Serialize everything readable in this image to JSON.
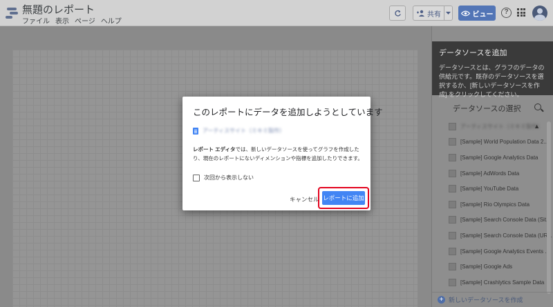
{
  "app": {
    "title": "無題のレポート",
    "menu": [
      "ファイル",
      "表示",
      "ページ",
      "ヘルプ"
    ]
  },
  "toolbar": {
    "share_label": "共有",
    "view_label": "ビュー"
  },
  "panel": {
    "heading": "データソースを追加",
    "description": "データソースとは、グラフのデータの供給元です。既存のデータソースを選択するか、[新しいデータソースを作成] をクリックしてください。",
    "subheading": "データソースの選択",
    "items": [
      "アーティスサイト（ミキミ製作）",
      "[Sample] World Population Data 2...",
      "[Sample] Google Analytics Data",
      "[Sample] AdWords Data",
      "[Sample] YouTube Data",
      "[Sample] Rio Olympics Data",
      "[Sample] Search Console Data (Sit...",
      "[Sample] Search Console Data (UR...",
      "[Sample] Google Analytics Events ...",
      "[Sample] Google Ads",
      "[Sample] Crashlytics Sample Data"
    ],
    "warning_glyph": "▲",
    "create_label": "新しいデータソースを作成"
  },
  "dialog": {
    "title": "このレポートにデータを追加しようとしています",
    "source_name": "アーティスサイト（ミキミ製作）",
    "desc_bold": "レポート エディタ",
    "desc_rest": "では、新しいデータソースを使ってグラフを作成したり、現在のレポートにないディメンションや指標を追加したりできます。",
    "checkbox_label": "次回から表示しない",
    "cancel_label": "キャンセル",
    "add_label": "レポートに追加"
  },
  "colors": {
    "primary": "#4285f4",
    "highlight": "#e3001b"
  }
}
